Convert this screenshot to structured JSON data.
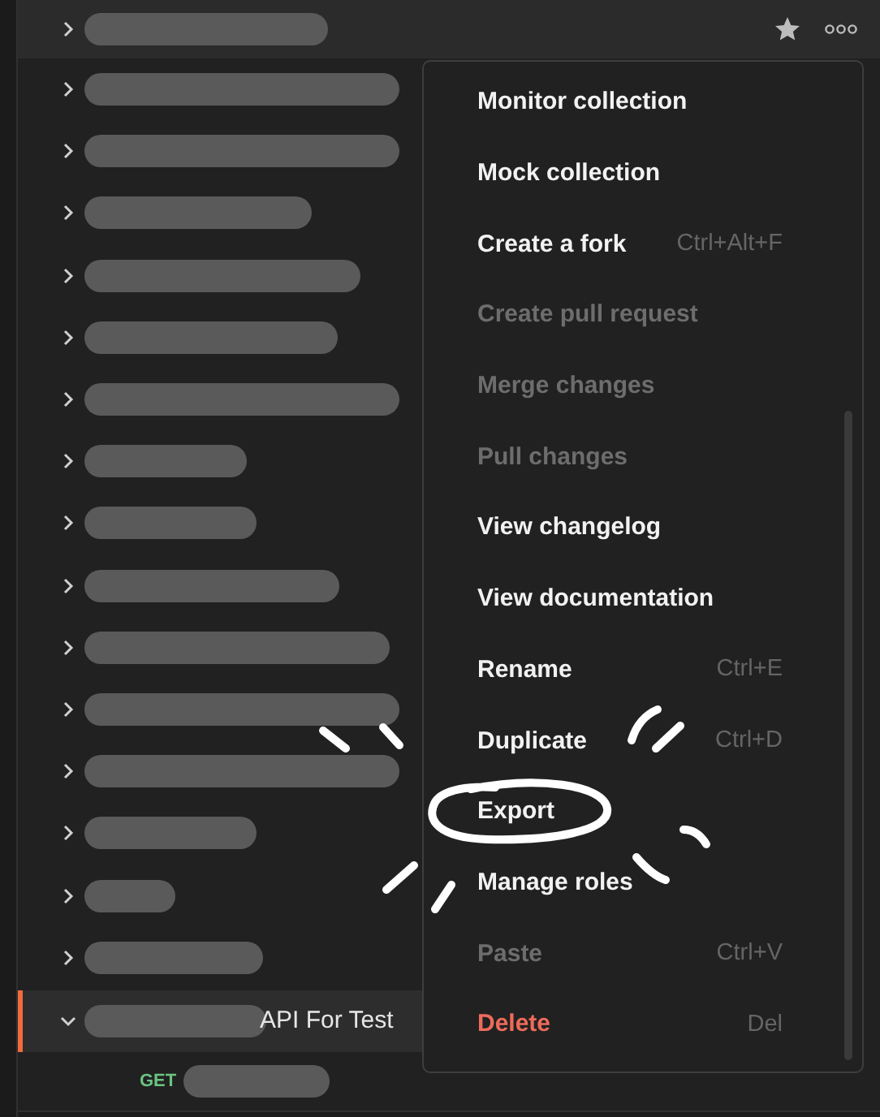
{
  "collections": [
    {
      "expanded": false,
      "selected": false,
      "hovered": true
    },
    {
      "expanded": false,
      "selected": false,
      "hovered": false
    },
    {
      "expanded": false,
      "selected": false,
      "hovered": false
    },
    {
      "expanded": false,
      "selected": false,
      "hovered": false
    },
    {
      "expanded": false,
      "selected": false,
      "hovered": false
    },
    {
      "expanded": false,
      "selected": false,
      "hovered": false
    },
    {
      "expanded": false,
      "selected": false,
      "hovered": false
    },
    {
      "expanded": false,
      "selected": false,
      "hovered": false
    },
    {
      "expanded": false,
      "selected": false,
      "hovered": false
    },
    {
      "expanded": false,
      "selected": false,
      "hovered": false
    },
    {
      "expanded": false,
      "selected": false,
      "hovered": false
    },
    {
      "expanded": false,
      "selected": false,
      "hovered": false
    },
    {
      "expanded": false,
      "selected": false,
      "hovered": false
    },
    {
      "expanded": false,
      "selected": false,
      "hovered": false
    },
    {
      "expanded": false,
      "selected": false,
      "hovered": false
    },
    {
      "expanded": false,
      "selected": false,
      "hovered": false
    },
    {
      "expanded": true,
      "selected": true,
      "hovered": false,
      "label": "API For Test",
      "children": [
        {
          "method": "GET"
        }
      ]
    }
  ],
  "context_menu": {
    "items": [
      {
        "label": "Monitor collection",
        "disabled": false,
        "kind": "action"
      },
      {
        "label": "Mock collection",
        "disabled": false,
        "kind": "action"
      },
      {
        "label": "Create a fork",
        "shortcut": "Ctrl+Alt+F",
        "disabled": false,
        "kind": "action"
      },
      {
        "label": "Create pull request",
        "disabled": true,
        "kind": "action"
      },
      {
        "label": "Merge changes",
        "disabled": true,
        "kind": "action"
      },
      {
        "label": "Pull changes",
        "disabled": true,
        "kind": "action"
      },
      {
        "label": "View changelog",
        "disabled": false,
        "kind": "action"
      },
      {
        "label": "View documentation",
        "disabled": false,
        "kind": "action"
      },
      {
        "label": "Rename",
        "shortcut": "Ctrl+E",
        "disabled": false,
        "kind": "action"
      },
      {
        "label": "Duplicate",
        "shortcut": "Ctrl+D",
        "disabled": false,
        "kind": "action"
      },
      {
        "label": "Export",
        "disabled": false,
        "kind": "action"
      },
      {
        "label": "Manage roles",
        "disabled": false,
        "kind": "action"
      },
      {
        "label": "Paste",
        "shortcut": "Ctrl+V",
        "disabled": true,
        "kind": "action"
      },
      {
        "label": "Delete",
        "shortcut": "Del",
        "disabled": false,
        "kind": "danger"
      }
    ]
  }
}
